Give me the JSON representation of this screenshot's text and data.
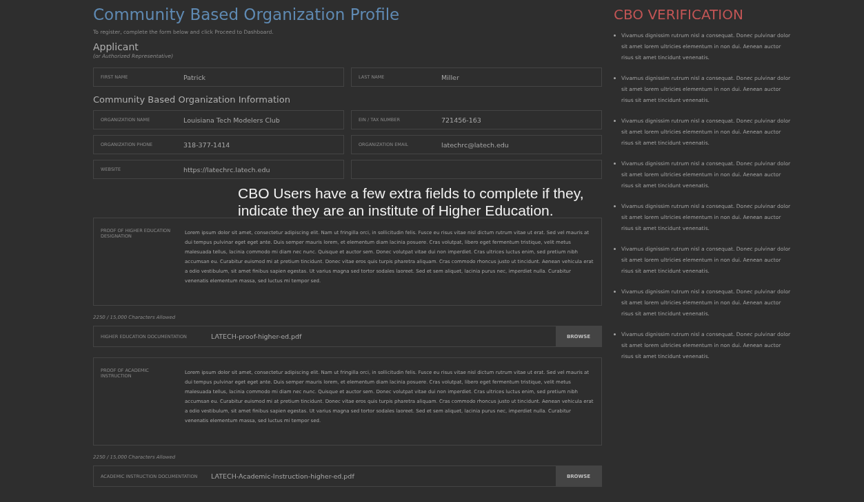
{
  "header": {
    "title": "Community Based Organization Profile",
    "subtitle": "To register, complete the form below and click Proceed to Dashboard."
  },
  "applicant": {
    "heading": "Applicant",
    "note": "(or Authorized Representative)",
    "fields": [
      {
        "kind": "text",
        "label": "FIRST NAME",
        "value": "Patrick"
      },
      {
        "kind": "text",
        "label": "LAST NAME",
        "value": "Miller"
      }
    ]
  },
  "organization": {
    "heading": "Community Based Organization Information",
    "rows": [
      [
        {
          "kind": "text",
          "label": "ORGANIZATION NAME",
          "value": "Louisiana Tech Modelers Club"
        },
        {
          "kind": "text",
          "label": "EIN / TAX NUMBER",
          "value": "721456-163"
        }
      ],
      [
        {
          "kind": "text",
          "label": "ORGANIZATION PHONE",
          "value": "318-377-1414"
        },
        {
          "kind": "text",
          "label": "ORGANIZATION EMAIL",
          "value": "latechrc@latech.edu"
        }
      ],
      [
        {
          "kind": "text",
          "label": "WEBSITE",
          "value": "https://latechrc.latech.edu"
        },
        {
          "kind": "covered"
        }
      ]
    ]
  },
  "documents": [
    {
      "label": "PROOF OF HIGHER EDUCATION DESIGNATION",
      "text": "Lorem ipsum dolor sit amet, consectetur adipiscing elit. Nam ut fringilla orci, in sollicitudin felis. Fusce eu risus vitae nisl dictum rutrum vitae ut erat. Sed vel mauris at dui tempus pulvinar eget eget ante. Duis semper mauris lorem, et elementum diam lacinia posuere. Cras volutpat, libero eget fermentum tristique, velit metus malesuada tellus, lacinia commodo mi diam nec nunc. Quisque et auctor sem. Donec volutpat vitae dui non imperdiet. Cras ultrices luctus enim, sed pretium nibh accumsan eu. Curabitur euismod mi at pretium tincidunt. Donec vitae eros quis turpis pharetra aliquam. Cras commodo rhoncus justo ut tincidunt. Aenean vehicula erat a odio vestibulum, sit amet finibus sapien egestas. Ut varius magna sed tortor sodales laoreet. Sed et sem aliquet, lacinia purus nec, imperdiet nulla. Curabitur venenatis elementum massa, sed luctus mi tempor sed.",
      "counter": "2250 / 15,000 Characters Allowed",
      "file_label": "HIGHER EDUCATION DOCUMENTATION",
      "file_name": "LATECH-proof-higher-ed.pdf",
      "button": "BROWSE"
    },
    {
      "label": "PROOF OF ACADEMIC INSTRUCTION",
      "text": "Lorem ipsum dolor sit amet, consectetur adipiscing elit. Nam ut fringilla orci, in sollicitudin felis. Fusce eu risus vitae nisl dictum rutrum vitae ut erat. Sed vel mauris at dui tempus pulvinar eget eget ante. Duis semper mauris lorem, et elementum diam lacinia posuere. Cras volutpat, libero eget fermentum tristique, velit metus malesuada tellus, lacinia commodo mi diam nec nunc. Quisque et auctor sem. Donec volutpat vitae dui non imperdiet. Cras ultrices luctus enim, sed pretium nibh accumsan eu. Curabitur euismod mi at pretium tincidunt. Donec vitae eros quis turpis pharetra aliquam. Cras commodo rhoncus justo ut tincidunt. Aenean vehicula erat a odio vestibulum, sit amet finibus sapien egestas. Ut varius magna sed tortor sodales laoreet. Sed et sem aliquet, lacinia purus nec, imperdiet nulla. Curabitur venenatis elementum massa, sed luctus mi tempor sed.",
      "counter": "2250 / 15,000 Characters Allowed",
      "file_label": "ACADEMIC INSTRUCTION DOCUMENTATION",
      "file_name": "LATECH-Academic-Instruction-higher-ed.pdf",
      "button": "BROWSE"
    }
  ],
  "sidebar": {
    "title": "CBO VERIFICATION",
    "items": [
      "Vivamus dignissim rutrum nisl a consequat. Donec pulvinar dolor sit amet lorem ultricies elementum in non dui. Aenean auctor risus sit amet tincidunt venenatis.",
      "Vivamus dignissim rutrum nisl a consequat. Donec pulvinar dolor sit amet lorem ultricies elementum in non dui. Aenean auctor risus sit amet tincidunt venenatis.",
      "Vivamus dignissim rutrum nisl a consequat. Donec pulvinar dolor sit amet lorem ultricies elementum in non dui. Aenean auctor risus sit amet tincidunt venenatis.",
      "Vivamus dignissim rutrum nisl a consequat. Donec pulvinar dolor sit amet lorem ultricies elementum in non dui. Aenean auctor risus sit amet tincidunt venenatis.",
      "Vivamus dignissim rutrum nisl a consequat. Donec pulvinar dolor sit amet lorem ultricies elementum in non dui. Aenean auctor risus sit amet tincidunt venenatis.",
      "Vivamus dignissim rutrum nisl a consequat. Donec pulvinar dolor sit amet lorem ultricies elementum in non dui. Aenean auctor risus sit amet tincidunt venenatis.",
      "Vivamus dignissim rutrum nisl a consequat. Donec pulvinar dolor sit amet lorem ultricies elementum in non dui. Aenean auctor risus sit amet tincidunt venenatis.",
      "Vivamus dignissim rutrum nisl a consequat. Donec pulvinar dolor sit amet lorem ultricies elementum in non dui. Aenean auctor risus sit amet tincidunt venenatis."
    ]
  },
  "callout": {
    "text": "CBO Users have a few extra fields to complete if they, indicate they are an institute of Higher Education."
  }
}
